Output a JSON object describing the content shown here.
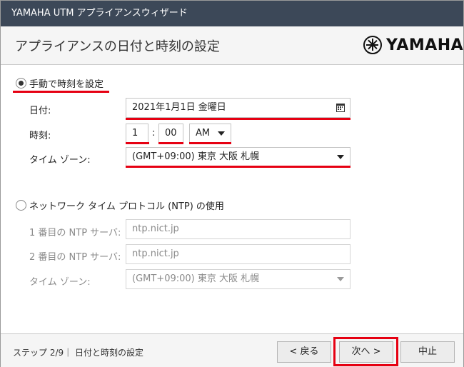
{
  "window": {
    "title": "YAMAHA UTM アプライアンスウィザード"
  },
  "header": {
    "title": "アプライアンスの日付と時刻の設定",
    "logo_text": "YAMAHA"
  },
  "manual": {
    "radio_label": "手動で時刻を設定",
    "date_label": "日付:",
    "date_value": "2021年1月1日 金曜日",
    "time_label": "時刻:",
    "hour_value": "1",
    "colon": ":",
    "minute_value": "00",
    "ampm_value": "AM",
    "timezone_label": "タイム ゾーン:",
    "timezone_value": "(GMT+09:00) 東京 大阪 札幌"
  },
  "ntp": {
    "radio_label": "ネットワーク タイム プロトコル (NTP) の使用",
    "server1_label": "1 番目の NTP サーバ:",
    "server1_value": "ntp.nict.jp",
    "server2_label": "2 番目の NTP サーバ:",
    "server2_value": "ntp.nict.jp",
    "timezone_label": "タイム ゾーン:",
    "timezone_value": "(GMT+09:00) 東京 大阪 札幌"
  },
  "footer": {
    "step_text": "ステップ 2/9｜ 日付と時刻の設定",
    "back_label": "< 戻る",
    "next_label": "次へ >",
    "cancel_label": "中止"
  },
  "colors": {
    "titlebar": "#3c4858",
    "highlight": "#e60012"
  }
}
